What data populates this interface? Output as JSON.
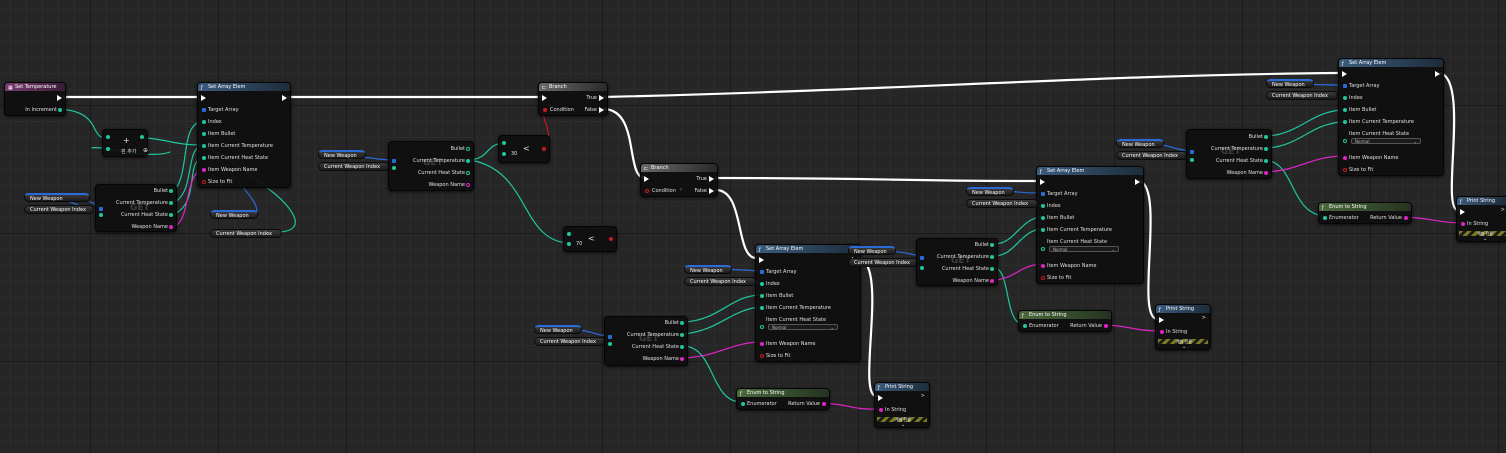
{
  "nodes": {
    "set_temperature": {
      "title": "Set Temperature",
      "in_increment": "In Increment"
    },
    "add_node": {
      "symbol": "+",
      "label": "핀 추가",
      "add_icon": "⊕"
    },
    "set_array_elem_1": {
      "title": "Set Array Elem",
      "target_array": "Target Array",
      "index": "Index",
      "item_bullet": "Item Bullet",
      "item_current_temperature": "Item Current Temperature",
      "item_current_heat_state": "Item Current Heat State",
      "item_weapon_name": "Item Weapon Name",
      "size_to_fit": "Size to Fit"
    },
    "get_1": {
      "get": "GET",
      "bullet": "Bullet",
      "current_temperature": "Current Temperature",
      "current_heat_state": "Current Heat State",
      "weapon_name": "Weapon Name"
    },
    "var_new_weapon_1": {
      "label": "New Weapon"
    },
    "var_current_weapon_index_1": {
      "label": "Current Weapon Index"
    },
    "var_new_weapon_2": {
      "label": "New Weapon"
    },
    "var_current_weapon_index_2": {
      "label": "Current Weapon Index"
    },
    "var_new_weapon_3": {
      "label": "New Weapon"
    },
    "var_current_weapon_index_3": {
      "label": "Current Weapon Index"
    },
    "get_2": {
      "get": "GET",
      "bullet": "Bullet",
      "current_temperature": "Current Temperature",
      "current_heat_state": "Current Heat State",
      "weapon_name": "Weapon Name"
    },
    "compare_30": {
      "symbol": "<",
      "value": "30"
    },
    "compare_70": {
      "symbol": "<",
      "value": "70"
    },
    "branch_1": {
      "title": "Branch",
      "condition": "Condition",
      "true": "True",
      "false": "False"
    },
    "branch_2": {
      "title": "Branch",
      "condition": "Condition",
      "true": "True",
      "false": "False"
    },
    "set_array_elem_2": {
      "title": "Set Array Elem",
      "target_array": "Target Array",
      "index": "Index",
      "item_bullet": "Item Bullet",
      "item_current_temperature": "Item Current Temperature",
      "item_current_heat_state": "Item Current Heat State",
      "heat_value": "Normal",
      "item_weapon_name": "Item Weapon Name",
      "size_to_fit": "Size to Fit"
    },
    "var_new_weapon_4": {
      "label": "New Weapon"
    },
    "var_current_weapon_index_4": {
      "label": "Current Weapon Index"
    },
    "var_new_weapon_5": {
      "label": "New Weapon"
    },
    "var_current_weapon_index_5": {
      "label": "Current Weapon Index"
    },
    "get_3": {
      "get": "GET",
      "bullet": "Bullet",
      "current_temperature": "Current Temperature",
      "current_heat_state": "Current Heat State",
      "weapon_name": "Weapon Name"
    },
    "enum_to_string_1": {
      "title": "Enum to String",
      "enumerator": "Enumerator",
      "return_value": "Return Value"
    },
    "print_string_1": {
      "title": "Print String",
      "in_string": "In String",
      "dev": "개발 전용"
    },
    "var_new_weapon_6": {
      "label": "New Weapon"
    },
    "var_current_weapon_index_6": {
      "label": "Current Weapon Index"
    },
    "get_4": {
      "get": "GET",
      "bullet": "Bullet",
      "current_temperature": "Current Temperature",
      "current_heat_state": "Current Heat State",
      "weapon_name": "Weapon Name"
    },
    "set_array_elem_3": {
      "title": "Set Array Elem",
      "target_array": "Target Array",
      "index": "Index",
      "item_bullet": "Item Bullet",
      "item_current_temperature": "Item Current Temperature",
      "item_current_heat_state": "Item Current Heat State",
      "heat_value": "Normal",
      "item_weapon_name": "Item Weapon Name",
      "size_to_fit": "Size to Fit"
    },
    "enum_to_string_2": {
      "title": "Enum to String",
      "enumerator": "Enumerator",
      "return_value": "Return Value"
    },
    "print_string_2": {
      "title": "Print String",
      "in_string": "In String",
      "dev": "개발 전용"
    },
    "var_new_weapon_7": {
      "label": "New Weapon"
    },
    "var_current_weapon_index_7": {
      "label": "Current Weapon Index"
    },
    "get_5": {
      "get": "GET",
      "bullet": "Bullet",
      "current_temperature": "Current Temperature",
      "current_heat_state": "Current Heat State",
      "weapon_name": "Weapon Name"
    },
    "set_array_elem_4": {
      "title": "Set Array Elem",
      "target_array": "Target Array",
      "index": "Index",
      "item_bullet": "Item Bullet",
      "item_current_temperature": "Item Current Temperature",
      "item_current_heat_state": "Item Current Heat State",
      "heat_value": "Normal",
      "item_weapon_name": "Item Weapon Name",
      "size_to_fit": "Size to Fit"
    },
    "enum_to_string_3": {
      "title": "Enum to String",
      "enumerator": "Enumerator",
      "return_value": "Return Value"
    },
    "print_string_3": {
      "title": "Print String",
      "in_string": "In String",
      "dev": "개발 전용"
    }
  },
  "colors": {
    "exec": "#ffffff",
    "float": "#1fc6a0",
    "string": "#e024c8",
    "struct_array": "#2a6bd8",
    "bool": "#c81a1a"
  }
}
